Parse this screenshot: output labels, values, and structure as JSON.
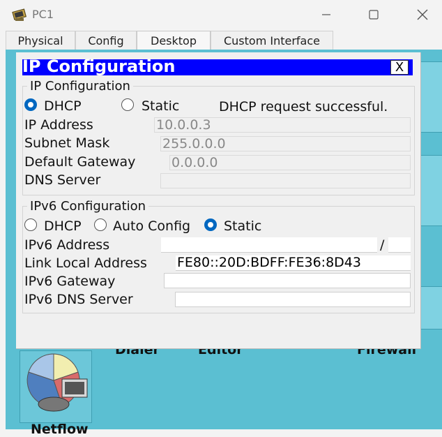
{
  "window": {
    "title": "PC1",
    "minimize_icon": "minimize-icon",
    "maximize_icon": "maximize-icon",
    "close_icon": "close-icon"
  },
  "tabs": [
    {
      "label": "Physical",
      "active": false
    },
    {
      "label": "Config",
      "active": false
    },
    {
      "label": "Desktop",
      "active": true
    },
    {
      "label": "Custom Interface",
      "active": false
    }
  ],
  "background_apps": {
    "dialer": "Dialer",
    "editor": "Editor",
    "firewall": "Firewall",
    "nettool": "Netflow"
  },
  "dialog": {
    "title": "IP Configuration",
    "close_label": "X",
    "ipv4": {
      "legend": "IP Configuration",
      "dhcp_label": "DHCP",
      "static_label": "Static",
      "mode": "DHCP",
      "status": "DHCP request successful.",
      "ip_label": "IP Address",
      "ip_value": "10.0.0.3",
      "mask_label": "Subnet Mask",
      "mask_value": "255.0.0.0",
      "gateway_label": "Default Gateway",
      "gateway_value": "0.0.0.0",
      "dns_label": "DNS Server",
      "dns_value": ""
    },
    "ipv6": {
      "legend": "IPv6 Configuration",
      "dhcp_label": "DHCP",
      "auto_label": "Auto Config",
      "static_label": "Static",
      "mode": "Static",
      "address_label": "IPv6 Address",
      "address_value": "",
      "prefix_sep": "/",
      "prefix_value": "",
      "link_local_label": "Link Local Address",
      "link_local_value": "FE80::20D:BDFF:FE36:8D43",
      "gateway_label": "IPv6 Gateway",
      "gateway_value": "",
      "dns_label": "IPv6 DNS Server",
      "dns_value": ""
    }
  }
}
